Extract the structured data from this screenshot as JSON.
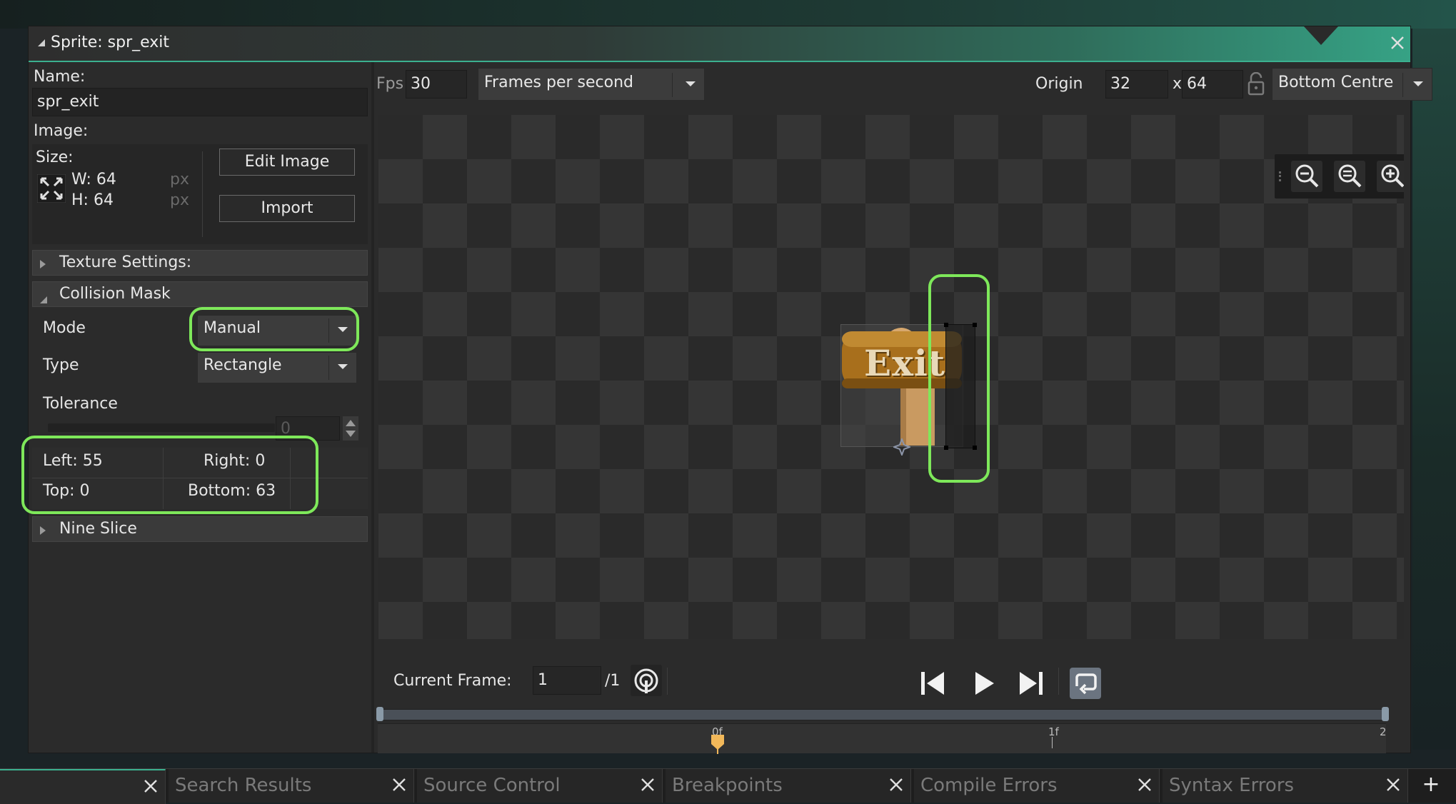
{
  "window": {
    "title": "Sprite: spr_exit"
  },
  "left": {
    "name_label": "Name:",
    "name_value": "spr_exit",
    "image_label": "Image:",
    "size_label": "Size:",
    "width_label": "W: 64",
    "height_label": "H: 64",
    "unit_px": "px",
    "edit_image_button": "Edit Image",
    "import_button": "Import",
    "texture_settings": "Texture Settings:",
    "collision_mask": "Collision Mask",
    "mode_label": "Mode",
    "mode_value": "Manual",
    "type_label": "Type",
    "type_value": "Rectangle",
    "tolerance_label": "Tolerance",
    "tolerance_value": "0",
    "left_bound": "Left: 55",
    "right_bound": "Right: 0",
    "top_bound": "Top: 0",
    "bottom_bound": "Bottom: 63",
    "nine_slice": "Nine Slice"
  },
  "toolbar": {
    "fps_label": "Fps",
    "fps_value": "30",
    "fps_mode": "Frames per second",
    "origin_label": "Origin",
    "origin_x": "32",
    "origin_sep": "x",
    "origin_y": "64",
    "origin_preset": "Bottom Centre"
  },
  "canvas": {
    "sign_text": "Exit",
    "zoom_icons": [
      "zoom-out-icon",
      "zoom-reset-icon",
      "zoom-in-icon",
      "fullscreen-icon"
    ]
  },
  "playback": {
    "current_frame_label": "Current Frame:",
    "current_frame_value": "1",
    "frame_total": "/1",
    "timeline_marks": [
      "0f",
      "1f",
      "2"
    ]
  },
  "bottom_tabs": [
    {
      "label": ""
    },
    {
      "label": "Search Results"
    },
    {
      "label": "Source Control"
    },
    {
      "label": "Breakpoints"
    },
    {
      "label": "Compile Errors"
    },
    {
      "label": "Syntax Errors"
    }
  ],
  "add_tab_label": "+",
  "colors": {
    "accent_teal": "#36a285",
    "highlight_green": "#7ee85a",
    "frame_marker": "#f2b85a",
    "sign_wood": "#a86f1c"
  }
}
